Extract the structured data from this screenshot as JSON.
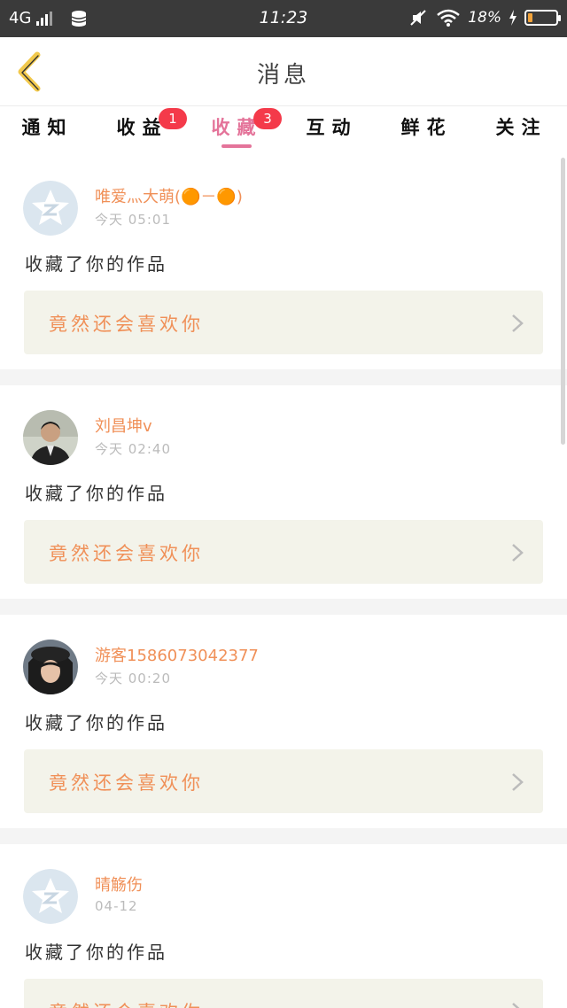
{
  "status_bar": {
    "network": "4G",
    "time": "11:23",
    "battery_percent": "18%",
    "battery_level": 0.18
  },
  "header": {
    "title": "消息"
  },
  "tabs": [
    {
      "label": "通知",
      "badge": ""
    },
    {
      "label": "收益",
      "badge": "1"
    },
    {
      "label": "收藏",
      "badge": "3",
      "active": true
    },
    {
      "label": "互动",
      "badge": ""
    },
    {
      "label": "鲜花",
      "badge": ""
    },
    {
      "label": "关注",
      "badge": ""
    }
  ],
  "messages": [
    {
      "username": "唯爱灬大萌(🟠－🟠)",
      "time": "今天 05:01",
      "text": "收藏了你的作品",
      "work_title": "竟然还会喜欢你",
      "avatar": "default-qq-avatar"
    },
    {
      "username": "刘昌坤v",
      "time": "今天 02:40",
      "text": "收藏了你的作品",
      "work_title": "竟然还会喜欢你",
      "avatar": "photo-man-in-suit"
    },
    {
      "username": "游客15860730423​77",
      "time": "今天 00:20",
      "text": "收藏了你的作品",
      "work_title": "竟然还会喜欢你",
      "avatar": "photo-woman-in-hat"
    },
    {
      "username": "晴觞伤",
      "time": "04-12",
      "text": "收藏了你的作品",
      "work_title": "竟然还会喜欢你",
      "avatar": "default-qq-avatar"
    }
  ],
  "colors": {
    "accent_pink": "#e4749a",
    "badge_red": "#f43a4a",
    "orange_text": "#f09058",
    "back_icon": "#f2c94c"
  }
}
